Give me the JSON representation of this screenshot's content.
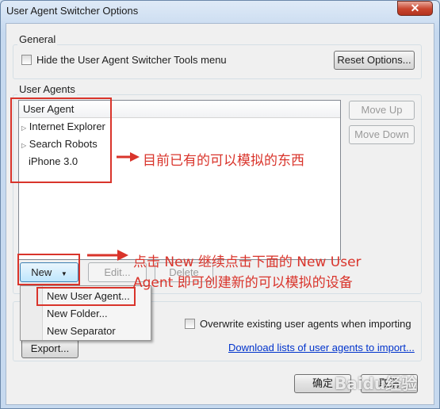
{
  "window": {
    "title": "User Agent Switcher Options",
    "close_label": "✕"
  },
  "general": {
    "group_label": "General",
    "hide_menu_label": "Hide the User Agent Switcher Tools menu",
    "hide_menu_checked": false,
    "reset_button": "Reset Options..."
  },
  "user_agents": {
    "group_label": "User Agents",
    "header": "User Agent",
    "items": [
      {
        "label": "Internet Explorer",
        "expandable": true
      },
      {
        "label": "Search Robots",
        "expandable": true
      },
      {
        "label": "iPhone 3.0",
        "expandable": false
      }
    ],
    "move_up": "Move Up",
    "move_down": "Move Down",
    "new_button": "New",
    "edit_button": "Edit...",
    "delete_button": "Delete"
  },
  "new_menu": {
    "items": [
      "New User Agent...",
      "New Folder...",
      "New Separator"
    ]
  },
  "import_export": {
    "overwrite_label": "Overwrite existing user agents when importing",
    "overwrite_checked": false,
    "export_button": "Export...",
    "download_link": "Download lists of user agents to import..."
  },
  "footer": {
    "ok_button": "确定",
    "cancel_button": "取消"
  },
  "annotations": {
    "existing": "目前已有的可以模拟的东西",
    "new_line1": "点击 New 继续点击下面的 New User",
    "new_line2": "Agent 即可创建新的可以模拟的设备",
    "color": "#d9342b"
  },
  "watermark": {
    "text": "Baidu经验"
  }
}
